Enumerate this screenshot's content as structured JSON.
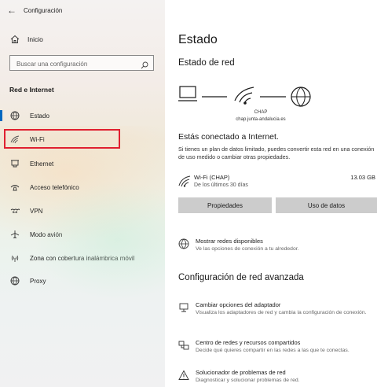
{
  "window": {
    "title": "Configuración"
  },
  "sidebar": {
    "home_label": "Inicio",
    "search_placeholder": "Buscar una configuración",
    "section_title": "Red e Internet",
    "items": [
      {
        "label": "Estado",
        "icon": "status-globe-icon",
        "selected": true
      },
      {
        "label": "Wi-Fi",
        "icon": "wifi-icon",
        "highlighted": true
      },
      {
        "label": "Ethernet",
        "icon": "ethernet-icon"
      },
      {
        "label": "Acceso telefónico",
        "icon": "dialup-icon"
      },
      {
        "label": "VPN",
        "icon": "vpn-icon"
      },
      {
        "label": "Modo avión",
        "icon": "airplane-icon"
      },
      {
        "label": "Zona con cobertura inalámbrica móvil",
        "icon": "hotspot-icon"
      },
      {
        "label": "Proxy",
        "icon": "proxy-globe-icon"
      }
    ]
  },
  "main": {
    "title": "Estado",
    "network_status_heading": "Estado de red",
    "network": {
      "name": "CHAP",
      "domain": "chap.junta-andalucia.es"
    },
    "connected_title": "Estás conectado a Internet.",
    "connected_desc": "Si tienes un plan de datos limitado, puedes convertir esta red en una conexión de uso medido o cambiar otras propiedades.",
    "wifi_usage": {
      "name": "Wi-Fi (CHAP)",
      "period": "De los últimos 30 días",
      "amount": "13.03 GB"
    },
    "buttons": {
      "properties": "Propiedades",
      "data_usage": "Uso de datos"
    },
    "show_networks": {
      "title": "Mostrar redes disponibles",
      "desc": "Ve las opciones de conexión a tu alrededor."
    },
    "advanced_heading": "Configuración de red avanzada",
    "advanced_items": [
      {
        "title": "Cambiar opciones del adaptador",
        "desc": "Visualiza los adaptadores de red y cambia la configuración de conexión.",
        "icon": "adapter-icon"
      },
      {
        "title": "Centro de redes y recursos compartidos",
        "desc": "Decide qué quieres compartir en las redes a las que te conectas.",
        "icon": "sharing-center-icon"
      },
      {
        "title": "Solucionador de problemas de red",
        "desc": "Diagnosticar y solucionar problemas de red.",
        "icon": "warning-icon"
      }
    ]
  },
  "colors": {
    "accent": "#0067c0",
    "highlight_box": "#e02030",
    "button_bg": "#cccccc"
  }
}
